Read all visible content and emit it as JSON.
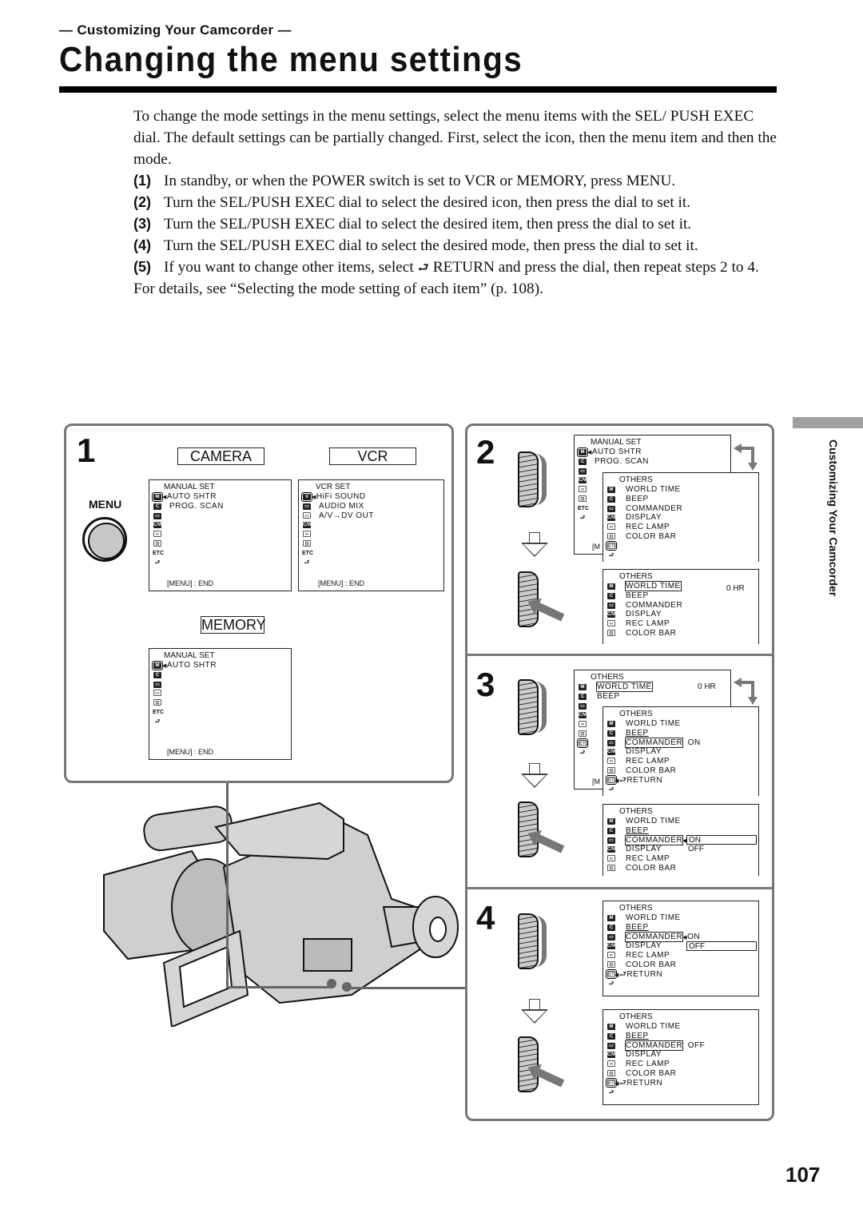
{
  "header": {
    "section_label": "— Customizing Your Camcorder —",
    "title": "Changing the menu settings"
  },
  "intro": "To change the mode settings in the menu settings, select the menu items with the SEL/ PUSH EXEC dial. The default settings can be partially changed. First, select the icon, then the menu item and then the mode.",
  "steps": [
    {
      "num": "(1)",
      "text": "In standby, or when the POWER switch is set to VCR or MEMORY, press MENU."
    },
    {
      "num": "(2)",
      "text": "Turn the SEL/PUSH EXEC dial to select the desired icon, then press the dial to set it."
    },
    {
      "num": "(3)",
      "text": "Turn the SEL/PUSH EXEC dial to select the desired item, then press the dial to set it."
    },
    {
      "num": "(4)",
      "text": "Turn the SEL/PUSH EXEC dial to select the desired mode, then press the dial to set it."
    },
    {
      "num": "(5)",
      "text_before": "If you want to change other items, select ",
      "return_glyph": "⮐",
      "text_after": " RETURN and press the dial, then repeat steps 2 to 4."
    }
  ],
  "footer_note": "For details, see “Selecting the mode setting of each item” (p. 108).",
  "panel1": {
    "step": "1",
    "menu_button_label": "MENU",
    "modes": {
      "camera": "CAMERA",
      "vcr": "VCR",
      "memory": "MEMORY"
    },
    "camera_screen": {
      "title": "MANUAL SET",
      "items": [
        "AUTO SHTR",
        "PROG. SCAN"
      ],
      "end": "[MENU] : END"
    },
    "vcr_screen": {
      "title": "VCR SET",
      "items": [
        "HiFi SOUND",
        "AUDIO MIX",
        "A/V→DV OUT"
      ],
      "end": "[MENU] : END"
    },
    "memory_screen": {
      "title": "MANUAL SET",
      "items": [
        "AUTO SHTR"
      ],
      "end": "[MENU] : END"
    }
  },
  "icons": {
    "m": "M",
    "c": "C",
    "cam": "▭",
    "cw": "C/W",
    "tape": "▭",
    "tool": "⊟",
    "etc": "ETC",
    "ret": "⮐"
  },
  "others": {
    "title": "OTHERS",
    "items": [
      "WORLD TIME",
      "BEEP",
      "COMMANDER",
      "DISPLAY",
      "REC LAMP",
      "COLOR BAR"
    ],
    "return": "RETURN",
    "world_time_value": "0  HR",
    "on": "ON",
    "off": "OFF"
  },
  "panel2": {
    "step": "2",
    "back_screen": {
      "title": "MANUAL SET",
      "items": [
        "AUTO SHTR",
        "PROG. SCAN"
      ],
      "end_partial": "[M"
    }
  },
  "panel3": {
    "step": "3",
    "end_partial": "[M"
  },
  "panel4": {
    "step": "4"
  },
  "side_tab": "Customizing Your Camcorder",
  "page_number": "107"
}
